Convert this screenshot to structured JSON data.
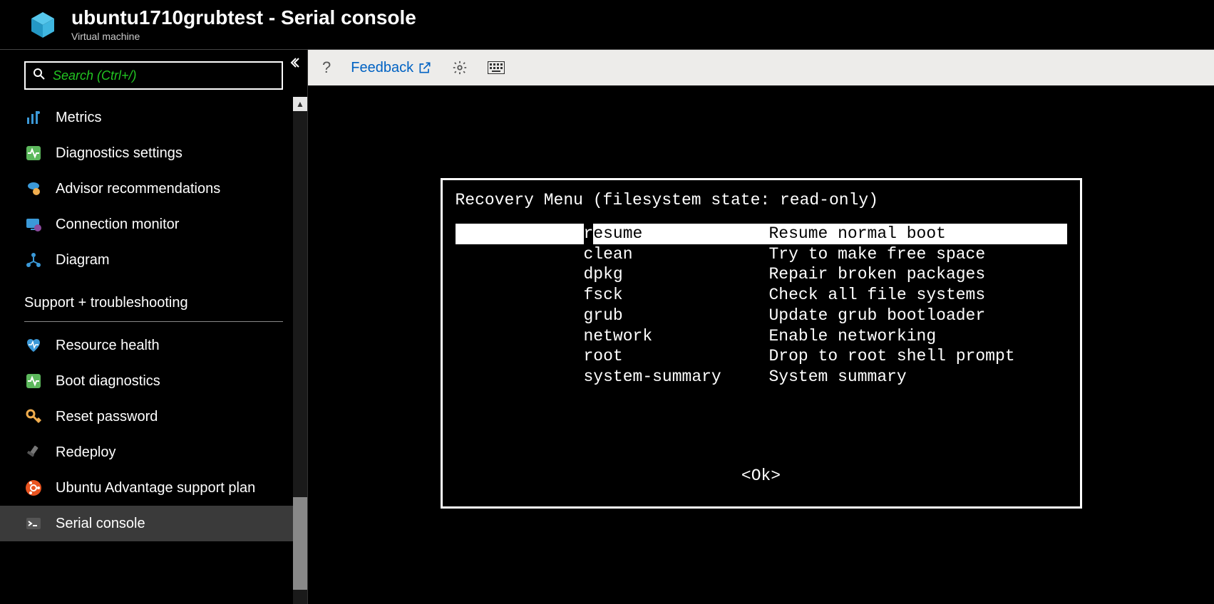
{
  "header": {
    "title": "ubuntu1710grubtest - Serial console",
    "subtitle": "Virtual machine"
  },
  "search": {
    "placeholder": "Search (Ctrl+/)"
  },
  "sidebar": {
    "items": [
      {
        "icon": "metrics",
        "label": "Metrics"
      },
      {
        "icon": "diag",
        "label": "Diagnostics settings"
      },
      {
        "icon": "advisor",
        "label": "Advisor recommendations"
      },
      {
        "icon": "connmon",
        "label": "Connection monitor"
      },
      {
        "icon": "diagram",
        "label": "Diagram"
      }
    ],
    "section_title": "Support + troubleshooting",
    "support_items": [
      {
        "icon": "heart",
        "label": "Resource health"
      },
      {
        "icon": "boot",
        "label": "Boot diagnostics"
      },
      {
        "icon": "key",
        "label": "Reset password"
      },
      {
        "icon": "redeploy",
        "label": "Redeploy"
      },
      {
        "icon": "ubuntu",
        "label": "Ubuntu Advantage support plan"
      },
      {
        "icon": "serial",
        "label": "Serial console",
        "active": true
      }
    ]
  },
  "toolbar": {
    "help": "?",
    "feedback": "Feedback"
  },
  "console": {
    "title": "Recovery Menu (filesystem state: read-only)",
    "menu": [
      {
        "key": "resume",
        "desc": "Resume normal boot",
        "selected": true
      },
      {
        "key": "clean",
        "desc": "Try to make free space"
      },
      {
        "key": "dpkg",
        "desc": "Repair broken packages"
      },
      {
        "key": "fsck",
        "desc": "Check all file systems"
      },
      {
        "key": "grub",
        "desc": "Update grub bootloader"
      },
      {
        "key": "network",
        "desc": "Enable networking"
      },
      {
        "key": "root",
        "desc": "Drop to root shell prompt"
      },
      {
        "key": "system-summary",
        "desc": "System summary"
      }
    ],
    "ok": "<Ok>"
  }
}
